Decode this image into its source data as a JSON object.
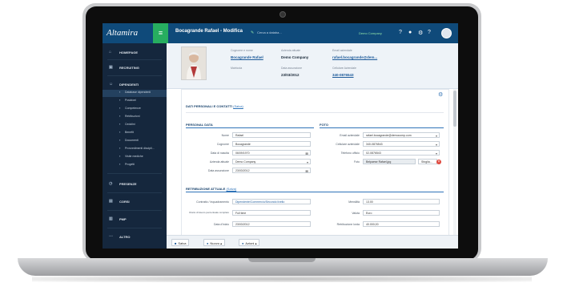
{
  "app": {
    "logo": "Altamira",
    "menu_icon": "hamburger-icon",
    "title": "Bocagrande Rafael - Modifica",
    "search_placeholder": "Cerca a databa...",
    "company_badge": "Demo Company"
  },
  "sidebar": {
    "items": [
      {
        "label": "HOMEPAGE",
        "icon": "home-icon"
      },
      {
        "label": "RECRUITING",
        "icon": "briefcase-icon"
      },
      {
        "label": "DIPENDENTI",
        "icon": "users-icon"
      }
    ],
    "subitems": [
      {
        "label": "Database dipendenti",
        "icon": "database-icon",
        "active": true
      },
      {
        "label": "Posizioni",
        "icon": "sitemap-icon"
      },
      {
        "label": "Competenze",
        "icon": "star-icon"
      },
      {
        "label": "Retribuzioni",
        "icon": "money-icon"
      },
      {
        "label": "Cedolini",
        "icon": "file-icon"
      },
      {
        "label": "Benefit",
        "icon": "gift-icon"
      },
      {
        "label": "Documenti",
        "icon": "folder-icon"
      },
      {
        "label": "Provvedimenti discipli...",
        "icon": "gavel-icon"
      },
      {
        "label": "Visite mediche",
        "icon": "medkit-icon"
      },
      {
        "label": "Progetti",
        "icon": "tasks-icon"
      }
    ],
    "bottom_items": [
      {
        "label": "PRESENZE",
        "icon": "clock-icon"
      },
      {
        "label": "CORSI",
        "icon": "book-icon"
      },
      {
        "label": "PMP",
        "icon": "chart-icon"
      },
      {
        "label": "ALTRO",
        "icon": "more-icon"
      }
    ]
  },
  "employee": {
    "name_label": "Cognome e nome",
    "name": "Bocagrande Rafael",
    "company_label": "Azienda attuale",
    "company": "Demo Company",
    "email_label": "Email aziendale",
    "email": "rafael.bocagrande@dem...",
    "matricola_label": "Matricola",
    "assunzione_label": "Data assunzione",
    "assunzione": "23/03/2012",
    "cell_label": "Cellulare Aziendale",
    "cell": "340-0876543"
  },
  "personal": {
    "section_title": "DATI PERSONALI E CONTATTI",
    "section_link": "(Salva)",
    "personal_title": "PERSONAL DATA",
    "photo_title": "FOTO",
    "fields": [
      {
        "label": "Nome",
        "value": "Rafael"
      },
      {
        "label": "Cognome",
        "value": "Bocagrande"
      },
      {
        "label": "Data di nascita",
        "value": "06/09/1970"
      },
      {
        "label": "Azienda attuale",
        "value": "Demo Company"
      },
      {
        "label": "Data assunzione",
        "value": "23/03/2012"
      }
    ],
    "right_fields": [
      {
        "label": "Email aziendale",
        "value": "rafael.bocagrande@democomp.com"
      },
      {
        "label": "Cellulare aziendale",
        "value": "340-0876543"
      },
      {
        "label": "Telefono ufficio",
        "value": "02-0876543"
      },
      {
        "label": "Foto",
        "value": "Belpaese Rafael.jpg"
      }
    ],
    "file_button": "Sfoglia...",
    "file_remove": "Sfoglia"
  },
  "salary": {
    "section_title": "RETRIBUZIONE ATTUALE",
    "section_link": "(Salva)",
    "left": [
      {
        "label": "Contratto / Inquadramento",
        "value": "Dipendente/Commercio/Secondo livello"
      },
      {
        "label": "Orario di lavoro percentuale completo",
        "value": "Full time"
      },
      {
        "label": "Data d'inizio",
        "value": "23/03/2012"
      }
    ],
    "right": [
      {
        "label": "Mensilità",
        "value": "13.00"
      },
      {
        "label": "Valuta",
        "value": "Euro"
      },
      {
        "label": "Retribuzione lorda",
        "value": "40.000,00"
      }
    ]
  },
  "footer": {
    "buttons": [
      {
        "label": "Salva",
        "icon": "save-icon"
      },
      {
        "label": "Nuovo",
        "icon": "plus-icon"
      },
      {
        "label": "Azioni",
        "icon": "cog-icon"
      }
    ]
  },
  "colors": {
    "topbar": "#0f4a7a",
    "sidebar": "#15273d",
    "accent_green": "#27ae60",
    "link_blue": "#1e5b9a"
  }
}
